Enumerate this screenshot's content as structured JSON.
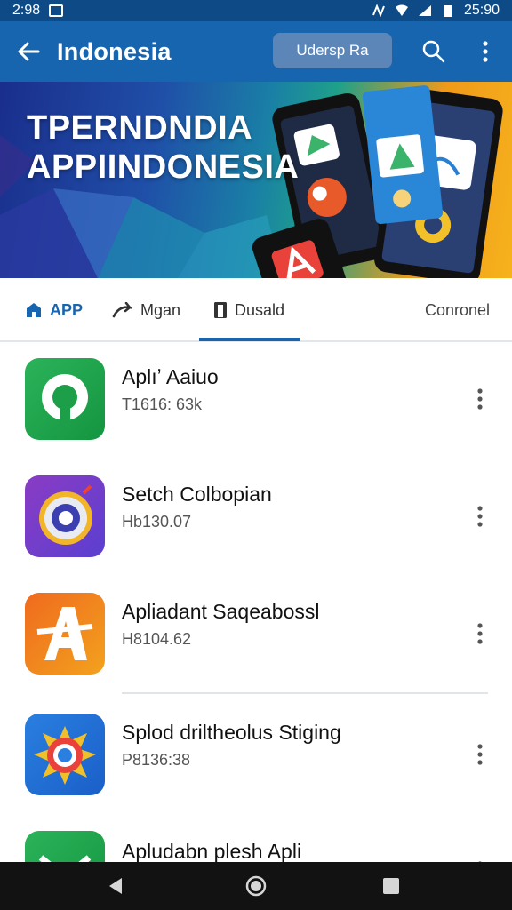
{
  "status_bar": {
    "time_left": "2:98",
    "time_right": "25:90"
  },
  "app_bar": {
    "title": "Indonesia",
    "chip_label": "Udersp Ra"
  },
  "banner": {
    "line1": "TPERNDNDIA",
    "line2": "APPIINDONESIA"
  },
  "tabs": [
    {
      "label": "APP",
      "icon": "house-icon",
      "active": false
    },
    {
      "label": "Mgan",
      "icon": "arrow-icon",
      "active": false
    },
    {
      "label": "Dusald",
      "icon": "book-icon",
      "active": true
    },
    {
      "label": "Conronel",
      "icon": "",
      "active": false
    }
  ],
  "apps": [
    {
      "name": "Aplıʼ Aaiuo",
      "sub": "T1616: 63k",
      "icon": "green-circle-app-icon"
    },
    {
      "name": "Setch Colbopian",
      "sub": "Hb130.07",
      "icon": "purple-ring-app-icon"
    },
    {
      "name": "Apliadant Saqeabossl",
      "sub": "H8104.62",
      "icon": "orange-letter-a-app-icon"
    },
    {
      "name": "Splod drilthеolus Stiging",
      "sub": "P8136:38",
      "icon": "blue-sunburst-app-icon"
    },
    {
      "name": "Apludabn plesh Apli",
      "sub": "",
      "icon": "green-mail-app-icon"
    }
  ],
  "colors": {
    "primary": "#1665ae",
    "status": "#0d4a86",
    "chip": "#5b86b7"
  }
}
